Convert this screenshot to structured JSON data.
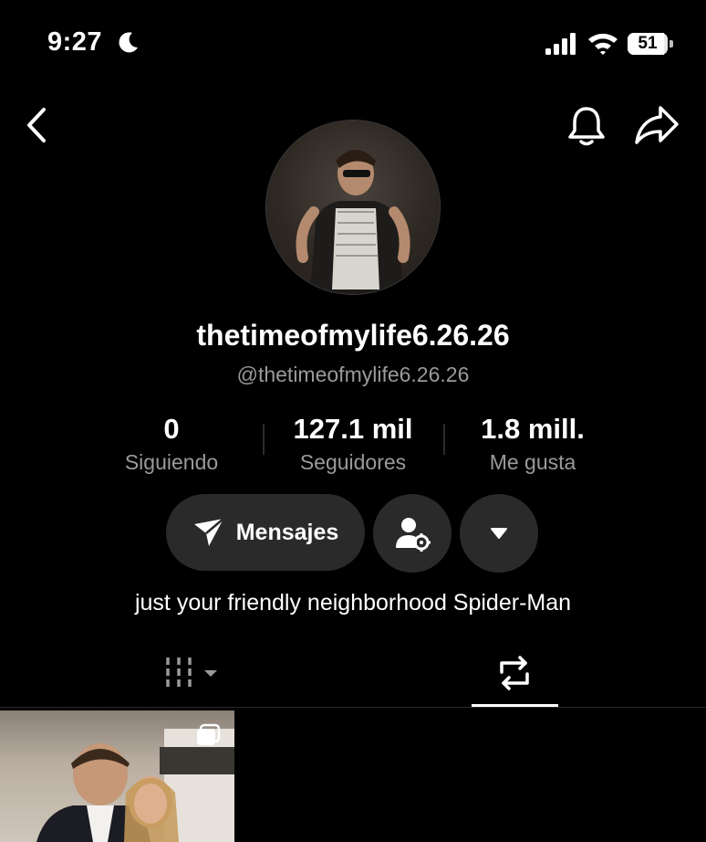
{
  "status_bar": {
    "time": "9:27",
    "battery": "51",
    "icons": [
      "moon-icon",
      "signal-icon",
      "wifi-icon",
      "battery-icon"
    ]
  },
  "header": {
    "icons": [
      "back-chevron-icon",
      "bell-icon",
      "share-arrow-icon"
    ]
  },
  "profile": {
    "display_name": "thetimeofmylife6.26.26",
    "handle": "@thetimeofmylife6.26.26",
    "bio": "just your friendly neighborhood Spider-Man"
  },
  "stats": [
    {
      "value": "0",
      "label": "Siguiendo"
    },
    {
      "value": "127.1 mil",
      "label": "Seguidores"
    },
    {
      "value": "1.8 mill.",
      "label": "Me gusta"
    }
  ],
  "actions": {
    "messages_label": "Mensajes",
    "icons": [
      "send-icon",
      "person-settings-icon",
      "dropdown-triangle-icon"
    ]
  },
  "tabs": {
    "items": [
      "grid-icon",
      "repost-icon"
    ],
    "active": "repost-icon"
  },
  "colors": {
    "background": "#000000",
    "button_bg": "#2a2a2a",
    "muted_text": "#9a9a9a",
    "text": "#ffffff"
  }
}
